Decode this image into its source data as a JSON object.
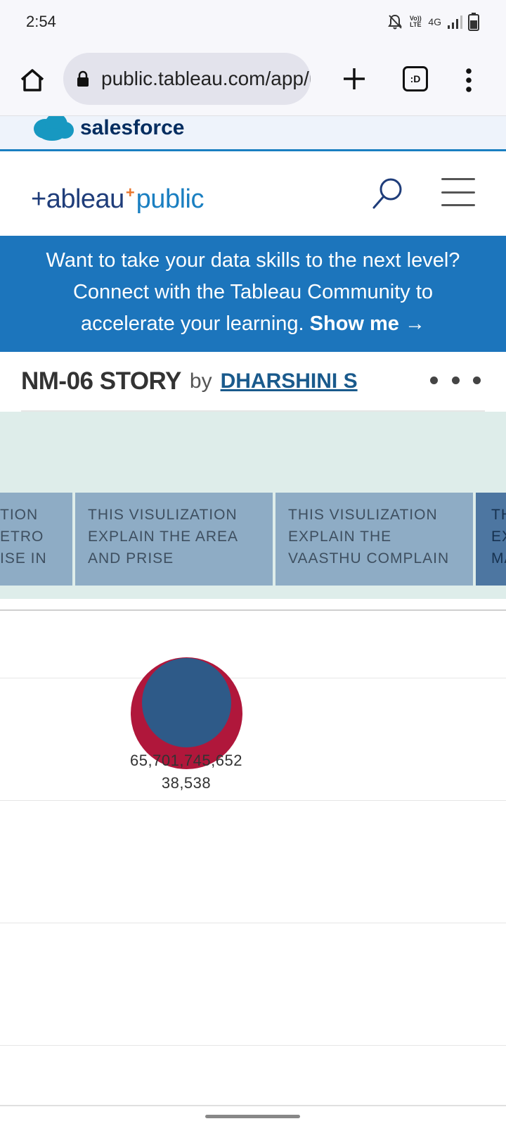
{
  "status_bar": {
    "time": "2:54",
    "network": "4G",
    "volte": "Vo)) LTE"
  },
  "browser": {
    "url": "public.tableau.com/app/profile/dharshini",
    "tabs_badge": ":D"
  },
  "salesforce_banner": {
    "text": "salesforce"
  },
  "tableau_logo": {
    "tableau": "+ableau",
    "plus": "+",
    "public": "public"
  },
  "promo": {
    "line1": "Want to take your data skills to the next level?",
    "line2": "Connect with the Tableau Community to",
    "line3": "accelerate your learning.",
    "link_label": "Show me →"
  },
  "viz": {
    "title": "NM-06 STORY",
    "by": "by",
    "author": "DHARSHINI S"
  },
  "story_points": [
    {
      "lines": [
        "TION",
        "ETRO",
        "ISE IN"
      ]
    },
    {
      "lines": [
        "THIS VISULIZATION",
        "EXPLAIN THE AREA",
        "AND PRISE"
      ]
    },
    {
      "lines": [
        "THIS VISULIZATION",
        "EXPLAIN THE",
        "VAASTHU COMPLAIN"
      ]
    },
    {
      "lines": [
        "TH",
        "EX",
        "MA"
      ]
    }
  ],
  "chart_data": {
    "type": "scatter",
    "labels": [
      "65,701,745,652",
      "38,538"
    ],
    "colors": {
      "outer": "#b0173b",
      "inner": "#2e5a88"
    }
  },
  "colors": {
    "promo_bg": "#1c75bc",
    "story_bg": "#deedea",
    "story_point": "#8eacc5",
    "story_point_active": "#4d76a1"
  }
}
